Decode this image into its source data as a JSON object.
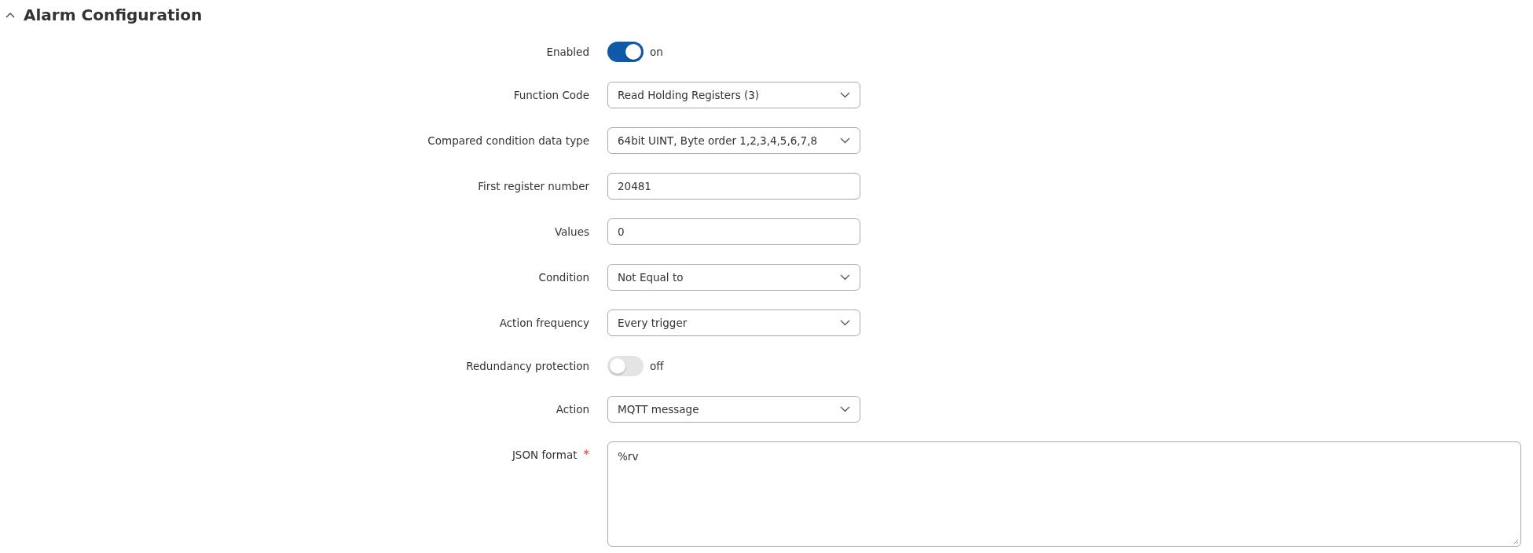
{
  "section": {
    "title": "Alarm Configuration",
    "expanded": true
  },
  "fields": [
    {
      "kind": "toggle",
      "label": "Enabled",
      "on": true,
      "state_text": "on"
    },
    {
      "kind": "select",
      "label": "Function Code",
      "value": "Read Holding Registers (3)"
    },
    {
      "kind": "select",
      "label": "Compared condition data type",
      "value": "64bit UINT, Byte order 1,2,3,4,5,6,7,8"
    },
    {
      "kind": "text",
      "label": "First register number",
      "value": "20481"
    },
    {
      "kind": "text",
      "label": "Values",
      "value": "0"
    },
    {
      "kind": "select",
      "label": "Condition",
      "value": "Not Equal to"
    },
    {
      "kind": "select",
      "label": "Action frequency",
      "value": "Every trigger"
    },
    {
      "kind": "toggle",
      "label": "Redundancy protection",
      "on": false,
      "state_text": "off"
    },
    {
      "kind": "select",
      "label": "Action",
      "value": "MQTT message"
    },
    {
      "kind": "textarea",
      "label": "JSON format",
      "required": true,
      "required_mark": "*",
      "value": "%rv"
    }
  ]
}
